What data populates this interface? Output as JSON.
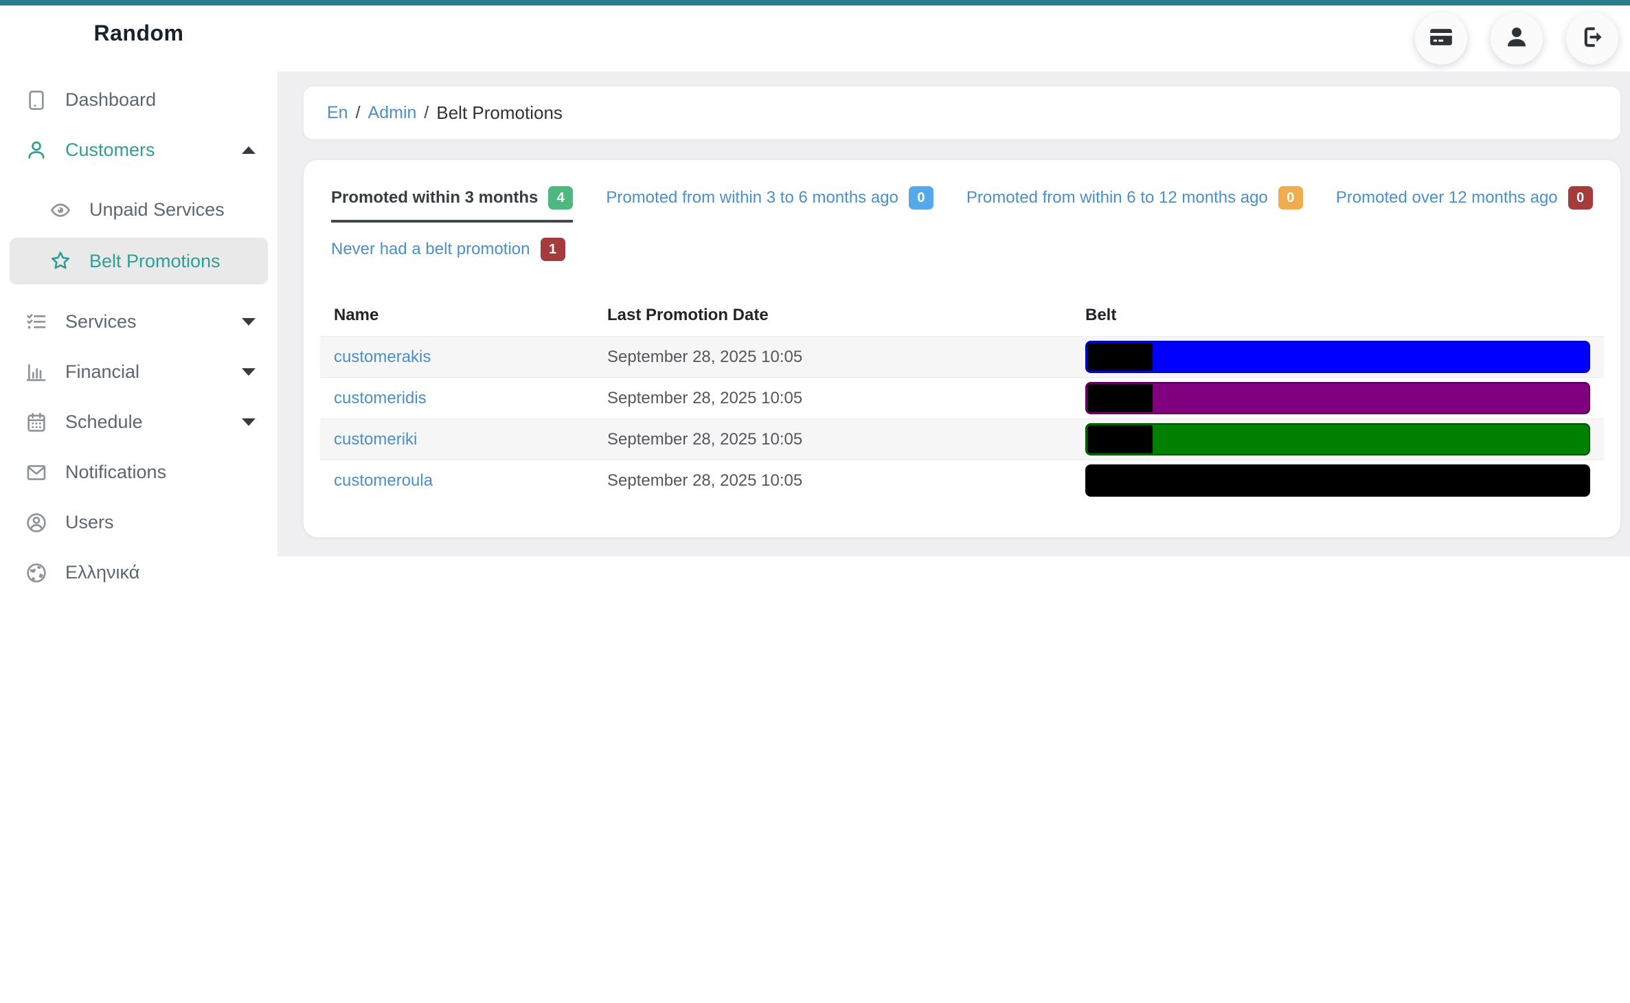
{
  "theme": {
    "topbar_teal": "#2a7e8b",
    "accent_teal": "#2f9e93",
    "link_blue": "#4a8fca",
    "active_tab_underline": "#43484d",
    "content_background": "#efeff1",
    "active_item_background": "#e9e9e9"
  },
  "sidebar": {
    "title": "Random",
    "items": [
      {
        "label": "Dashboard",
        "icon": "tablet-icon"
      },
      {
        "label": "Customers",
        "icon": "person-icon",
        "expanded": true
      },
      {
        "label": "Unpaid Services",
        "icon": "eye-icon",
        "sub": true
      },
      {
        "label": "Belt Promotions",
        "icon": "star-icon",
        "sub": true,
        "active": true
      },
      {
        "label": "Services",
        "icon": "checklist-icon",
        "collapsed": true
      },
      {
        "label": "Financial",
        "icon": "bar-chart-icon",
        "collapsed": true
      },
      {
        "label": "Schedule",
        "icon": "calendar-icon",
        "collapsed": true
      },
      {
        "label": "Notifications",
        "icon": "envelope-icon"
      },
      {
        "label": "Users",
        "icon": "person-circle-icon"
      },
      {
        "label": "Ελληνικά",
        "icon": "globe-icon"
      }
    ]
  },
  "topbar": {
    "buttons": [
      {
        "name": "billing",
        "icon": "credit-card-icon"
      },
      {
        "name": "profile",
        "icon": "user-icon"
      },
      {
        "name": "logout",
        "icon": "sign-out-icon"
      }
    ]
  },
  "breadcrumb": {
    "separator": "/",
    "items": [
      {
        "label": "En",
        "link": true
      },
      {
        "label": "Admin",
        "link": true
      },
      {
        "label": "Belt Promotions",
        "link": false
      }
    ]
  },
  "tabs": [
    {
      "label": "Promoted within 3 months",
      "count": "4",
      "badge_color": "#4db87f",
      "active": true
    },
    {
      "label": "Promoted from within 3 to 6 months ago",
      "count": "0",
      "badge_color": "#56a9e8",
      "active": false
    },
    {
      "label": "Promoted from within 6 to 12 months ago",
      "count": "0",
      "badge_color": "#f0ad4e",
      "active": false
    },
    {
      "label": "Promoted over 12 months ago",
      "count": "0",
      "badge_color": "#a53b3b",
      "active": false
    },
    {
      "label": "Never had a belt promotion",
      "count": "1",
      "badge_color": "#a53b3b",
      "active": false
    }
  ],
  "table": {
    "headers": [
      "Name",
      "Last Promotion Date",
      "Belt"
    ],
    "rows": [
      {
        "name": "customerakis",
        "date": "September 28, 2025 10:05",
        "belt": "blue",
        "belt_color": "#0000ff",
        "belt_border": "#0000a6",
        "patch_color": "#000000"
      },
      {
        "name": "customeridis",
        "date": "September 28, 2025 10:05",
        "belt": "purple",
        "belt_color": "#800080",
        "belt_border": "#4d004d",
        "patch_color": "#000000"
      },
      {
        "name": "customeriki",
        "date": "September 28, 2025 10:05",
        "belt": "green",
        "belt_color": "#008000",
        "belt_border": "#024d02",
        "patch_color": "#000000"
      },
      {
        "name": "customeroula",
        "date": "September 28, 2025 10:05",
        "belt": "black",
        "belt_color": "#000000",
        "belt_border": "#000000",
        "patch_color": "#000000"
      }
    ]
  }
}
